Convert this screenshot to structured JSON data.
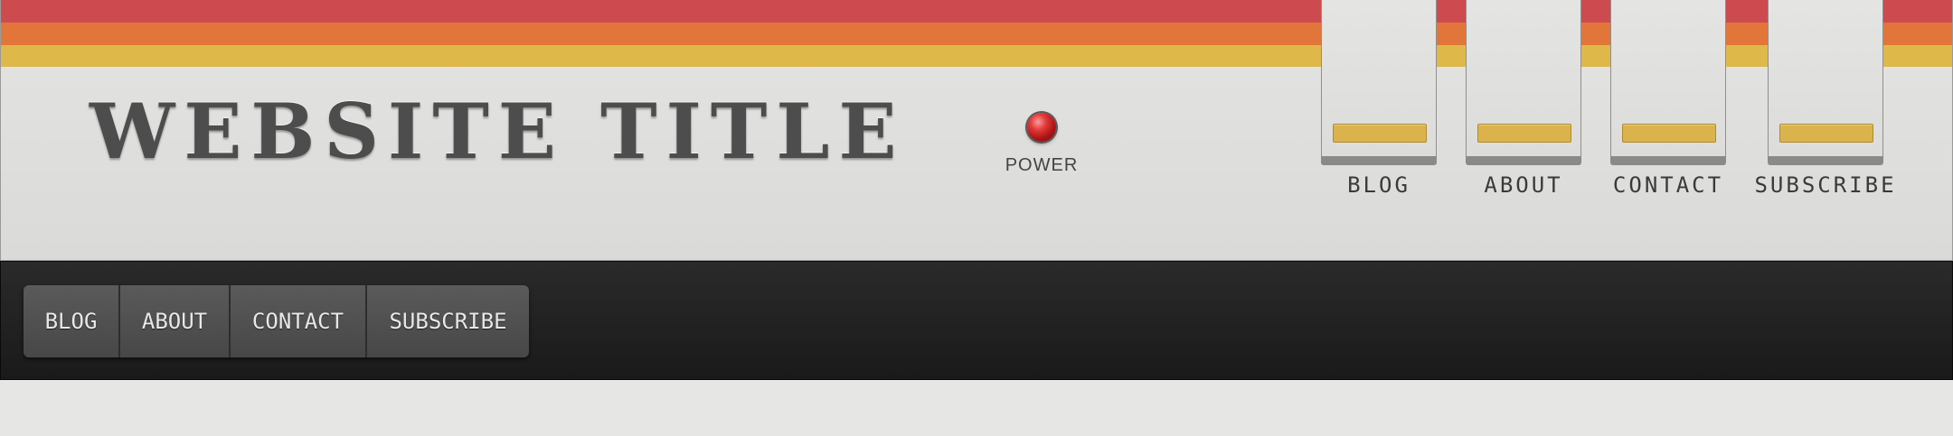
{
  "header": {
    "title": "WEBSITE TITLE",
    "power_label": "POWER",
    "stripe_colors": [
      "#cd4b4e",
      "#e2763a",
      "#dfb84a"
    ],
    "switches": [
      {
        "label": "BLOG"
      },
      {
        "label": "ABOUT"
      },
      {
        "label": "CONTACT"
      },
      {
        "label": "SUBSCRIBE"
      }
    ]
  },
  "navbar": {
    "items": [
      {
        "label": "BLOG"
      },
      {
        "label": "ABOUT"
      },
      {
        "label": "CONTACT"
      },
      {
        "label": "SUBSCRIBE"
      }
    ]
  }
}
